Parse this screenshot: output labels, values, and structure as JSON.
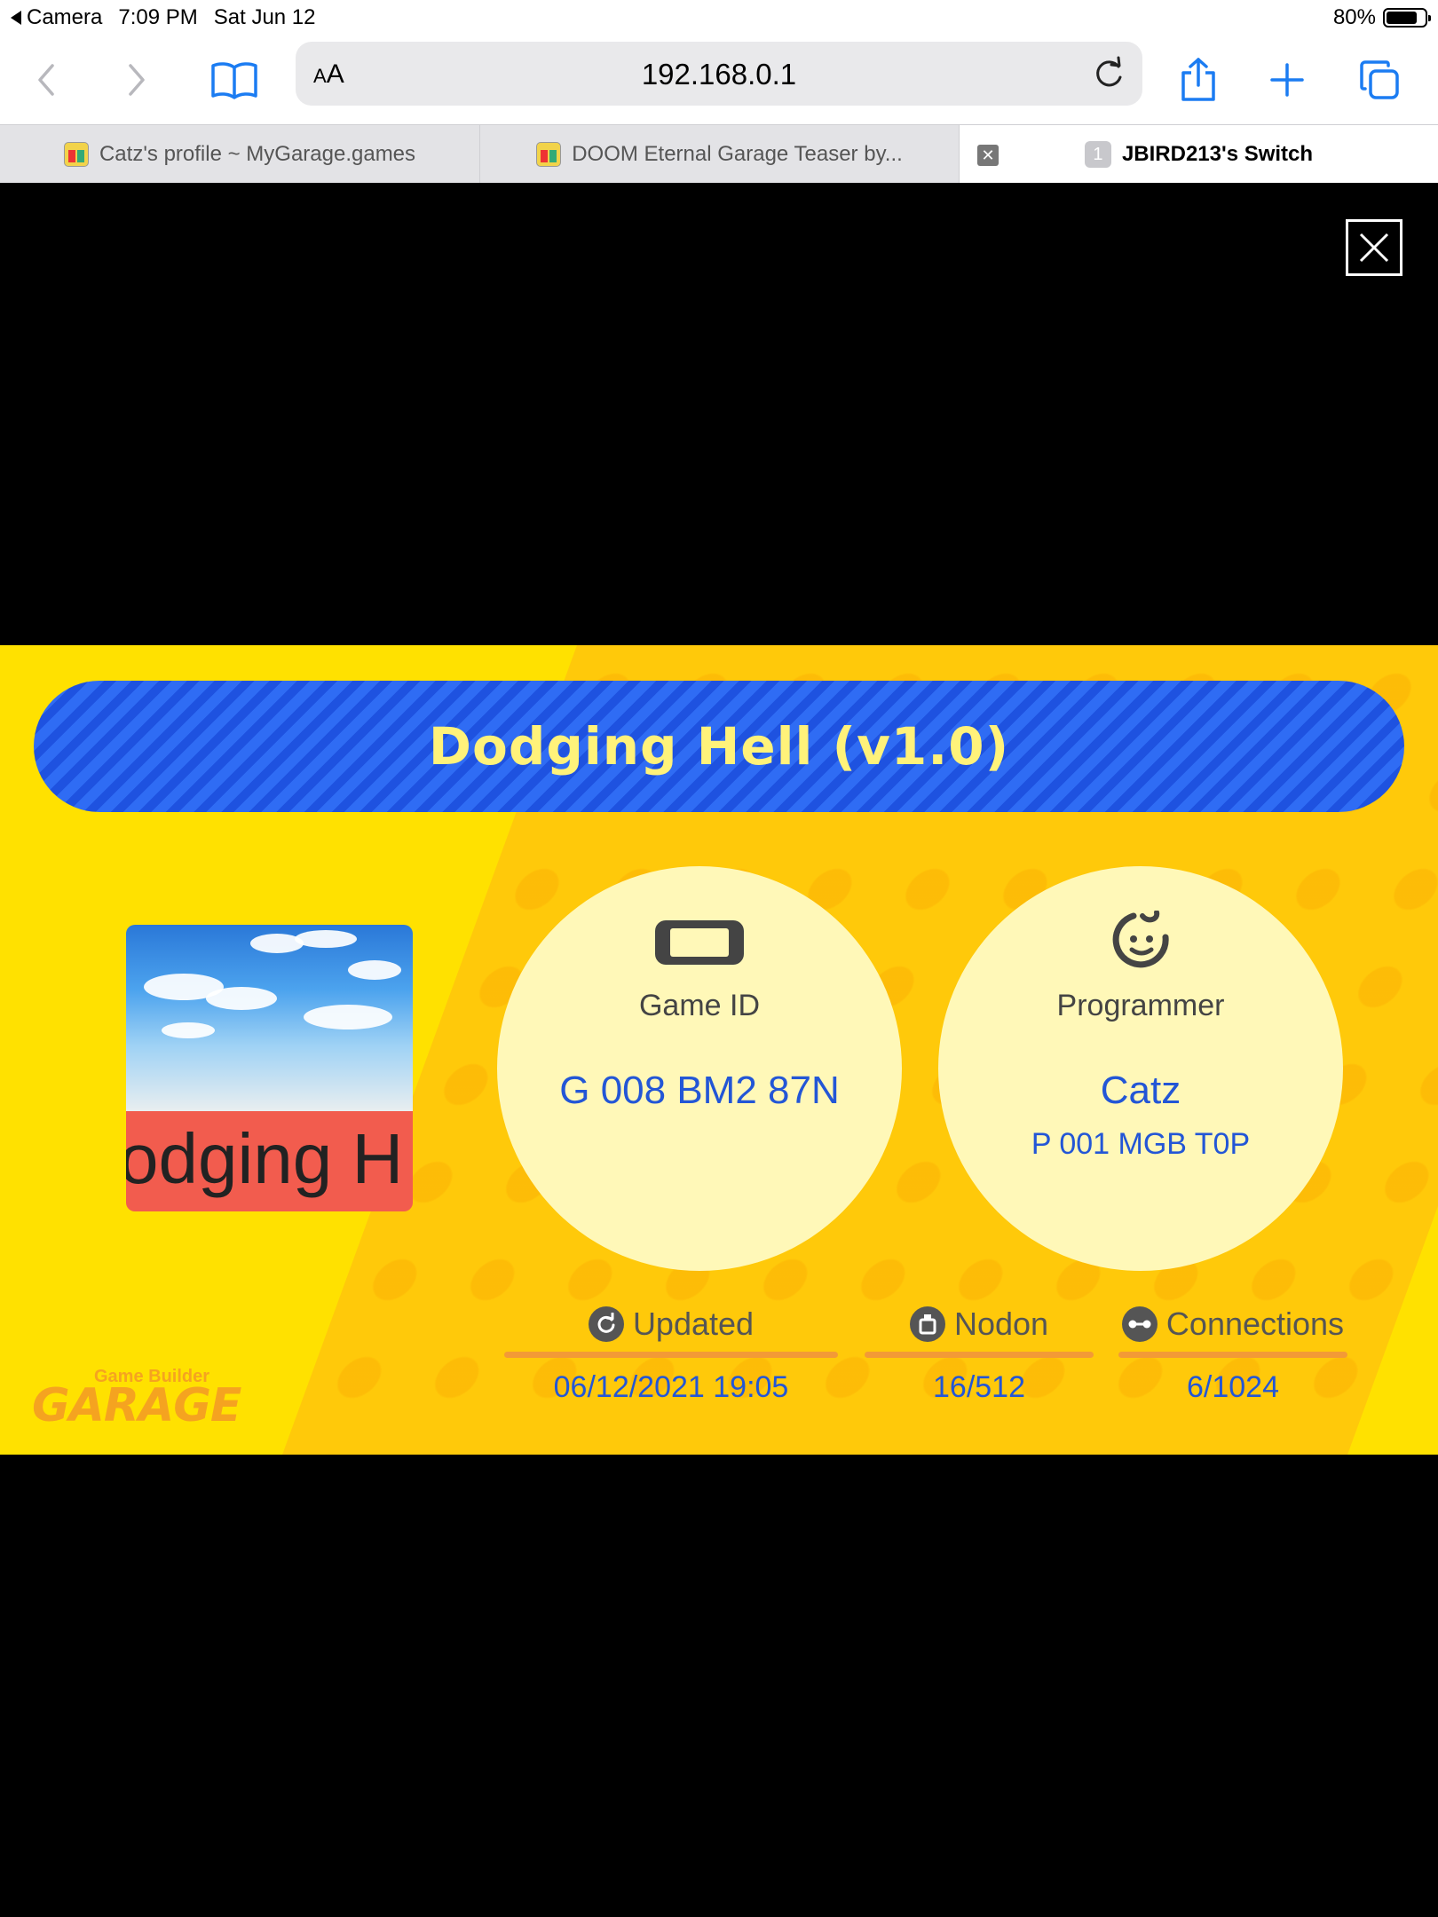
{
  "status_bar": {
    "back_app": "Camera",
    "time": "7:09 PM",
    "date": "Sat Jun 12",
    "battery": "80%",
    "battery_level": 0.8
  },
  "toolbar": {
    "text_size_label_small": "A",
    "text_size_label_big": "A",
    "url": "192.168.0.1"
  },
  "tabs": [
    {
      "title": "Catz's profile ~ MyGarage.games",
      "icon": "mygarage-favicon"
    },
    {
      "title": "DOOM Eternal Garage Teaser by...",
      "icon": "mygarage-favicon"
    },
    {
      "title": "JBIRD213's Switch",
      "badge": "1"
    }
  ],
  "game": {
    "title": "Dodging Hell (v1.0)",
    "thumbnail_text": "odging H",
    "game_id": {
      "label": "Game ID",
      "value": "G 008 BM2 87N",
      "icon": "switch-console-icon"
    },
    "programmer": {
      "label": "Programmer",
      "name": "Catz",
      "id": "P 001 MGB T0P",
      "icon": "programmer-face-icon"
    },
    "stats": [
      {
        "label": "Updated",
        "value": "06/12/2021 19:05",
        "icon": "refresh-icon"
      },
      {
        "label": "Nodon",
        "value": "16/512",
        "icon": "nodon-icon"
      },
      {
        "label": "Connections",
        "value": "6/1024",
        "icon": "connection-icon"
      }
    ],
    "logo": {
      "small": "Game Builder",
      "big": "GARAGE"
    }
  },
  "colors": {
    "card_yellow": "#ffe100",
    "title_blue": "#2f6cf4",
    "title_text": "#fff27a",
    "value_blue": "#2356d6",
    "accent_orange": "#f39a36"
  }
}
